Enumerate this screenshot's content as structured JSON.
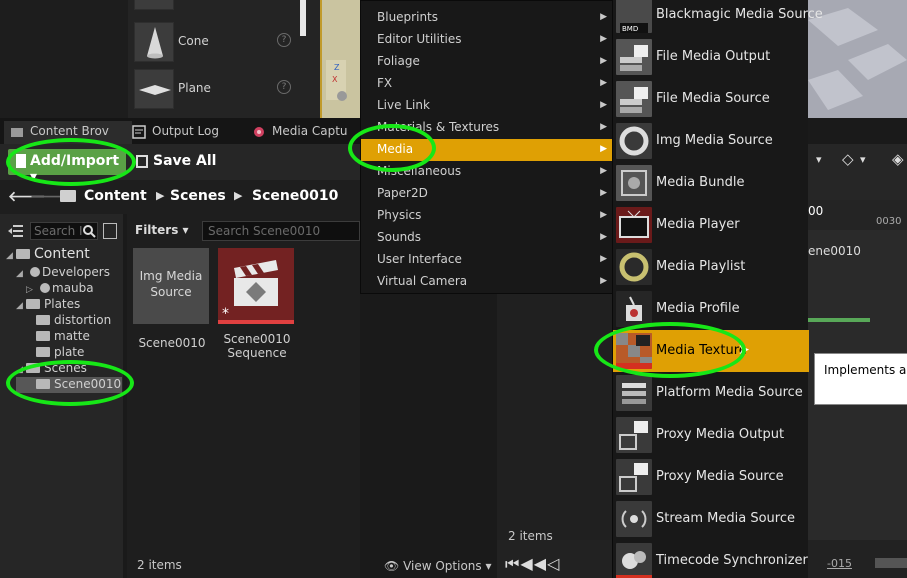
{
  "place_items": [
    {
      "label": "Cone",
      "help": "?"
    },
    {
      "label": "Plane",
      "help": "?"
    }
  ],
  "tabs": [
    {
      "label": "Content Brov"
    },
    {
      "label": "Output Log"
    },
    {
      "label": "Media Captu"
    }
  ],
  "toolbar": {
    "add_import": "Add/Import ▾",
    "save_all": "Save All"
  },
  "breadcrumb": [
    "Content",
    "Scenes",
    "Scene0010"
  ],
  "sources": {
    "search_placeholder": "Search I",
    "tree": [
      {
        "label": "Content",
        "level": 0
      },
      {
        "label": "Developers",
        "level": 1
      },
      {
        "label": "mauba",
        "level": 2
      },
      {
        "label": "Plates",
        "level": 1
      },
      {
        "label": "distortion",
        "level": 2
      },
      {
        "label": "matte",
        "level": 2
      },
      {
        "label": "plate",
        "level": 2
      },
      {
        "label": "Scenes",
        "level": 1
      },
      {
        "label": "Scene0010",
        "level": 2,
        "selected": true
      }
    ]
  },
  "assets": {
    "filters": "Filters ▾",
    "search_placeholder": "Search Scene0010",
    "tiles": [
      {
        "thumb_text": "Img Media Source",
        "label": "Scene0010"
      },
      {
        "label": "Scene0010 Sequence"
      }
    ],
    "items_count": "2 items",
    "view_options": "View Options ▾"
  },
  "menu1": [
    {
      "label": "Blueprints"
    },
    {
      "label": "Editor Utilities"
    },
    {
      "label": "Foliage"
    },
    {
      "label": "FX"
    },
    {
      "label": "Live Link"
    },
    {
      "label": "Materials & Textures"
    },
    {
      "label": "Media",
      "active": true
    },
    {
      "label": "Miscellaneous"
    },
    {
      "label": "Paper2D"
    },
    {
      "label": "Physics"
    },
    {
      "label": "Sounds"
    },
    {
      "label": "User Interface"
    },
    {
      "label": "Virtual Camera"
    }
  ],
  "menu2": [
    {
      "label": "Blackmagic Media Source",
      "icon": "blackmagic-icon"
    },
    {
      "label": "File Media Output",
      "icon": "file-output-icon"
    },
    {
      "label": "File Media Source",
      "icon": "file-source-icon"
    },
    {
      "label": "Img Media Source",
      "icon": "ring-icon"
    },
    {
      "label": "Media Bundle",
      "icon": "bundle-icon"
    },
    {
      "label": "Media Player",
      "icon": "tv-icon"
    },
    {
      "label": "Media Playlist",
      "icon": "playlist-icon"
    },
    {
      "label": "Media Profile",
      "icon": "profile-icon"
    },
    {
      "label": "Media Texture",
      "icon": "texture-icon",
      "active": true
    },
    {
      "label": "Platform Media Source",
      "icon": "platform-icon"
    },
    {
      "label": "Proxy Media Output",
      "icon": "proxy-output-icon"
    },
    {
      "label": "Proxy Media Source",
      "icon": "proxy-source-icon"
    },
    {
      "label": "Stream Media Source",
      "icon": "stream-icon"
    },
    {
      "label": "Timecode Synchronizer",
      "icon": "timecode-icon"
    }
  ],
  "tooltip": "Implements a texture",
  "sequencer": {
    "items_count": "2 items",
    "time_00": "00",
    "time_0030": "0030",
    "track": "ene0010",
    "frame": "-015"
  },
  "colors": {
    "accent": "#dfa004",
    "highlight": "#17e717",
    "add_button": "#5aa146"
  }
}
